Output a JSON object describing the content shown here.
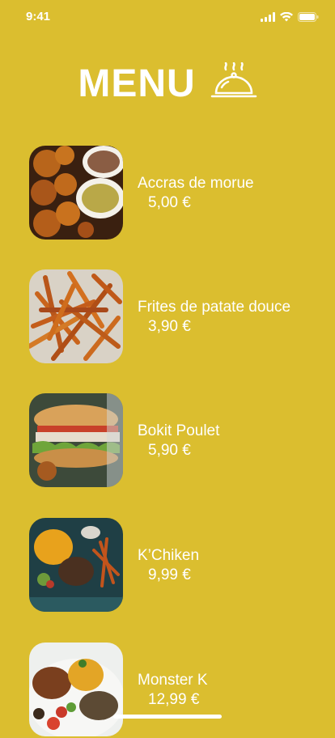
{
  "status_bar": {
    "time": "9:41",
    "icons": [
      "cellular-signal-icon",
      "wifi-icon",
      "battery-icon"
    ]
  },
  "header": {
    "title": "MENU",
    "icon": "serving-cloche-icon"
  },
  "menu_items": [
    {
      "name": "Accras de morue",
      "price": "5,00 €",
      "image": "accras-photo"
    },
    {
      "name": "Frites de patate douce",
      "price": "3,90 €",
      "image": "sweet-potato-fries-photo"
    },
    {
      "name": "Bokit Poulet",
      "price": "5,90 €",
      "image": "bokit-sandwich-photo"
    },
    {
      "name": "K’Chiken",
      "price": "9,99 €",
      "image": "kchiken-plate-photo"
    },
    {
      "name": "Monster K",
      "price": "12,99 €",
      "image": "monster-k-plate-photo"
    }
  ],
  "colors": {
    "background": "#DBBE2F",
    "text": "#FFFFFF"
  }
}
